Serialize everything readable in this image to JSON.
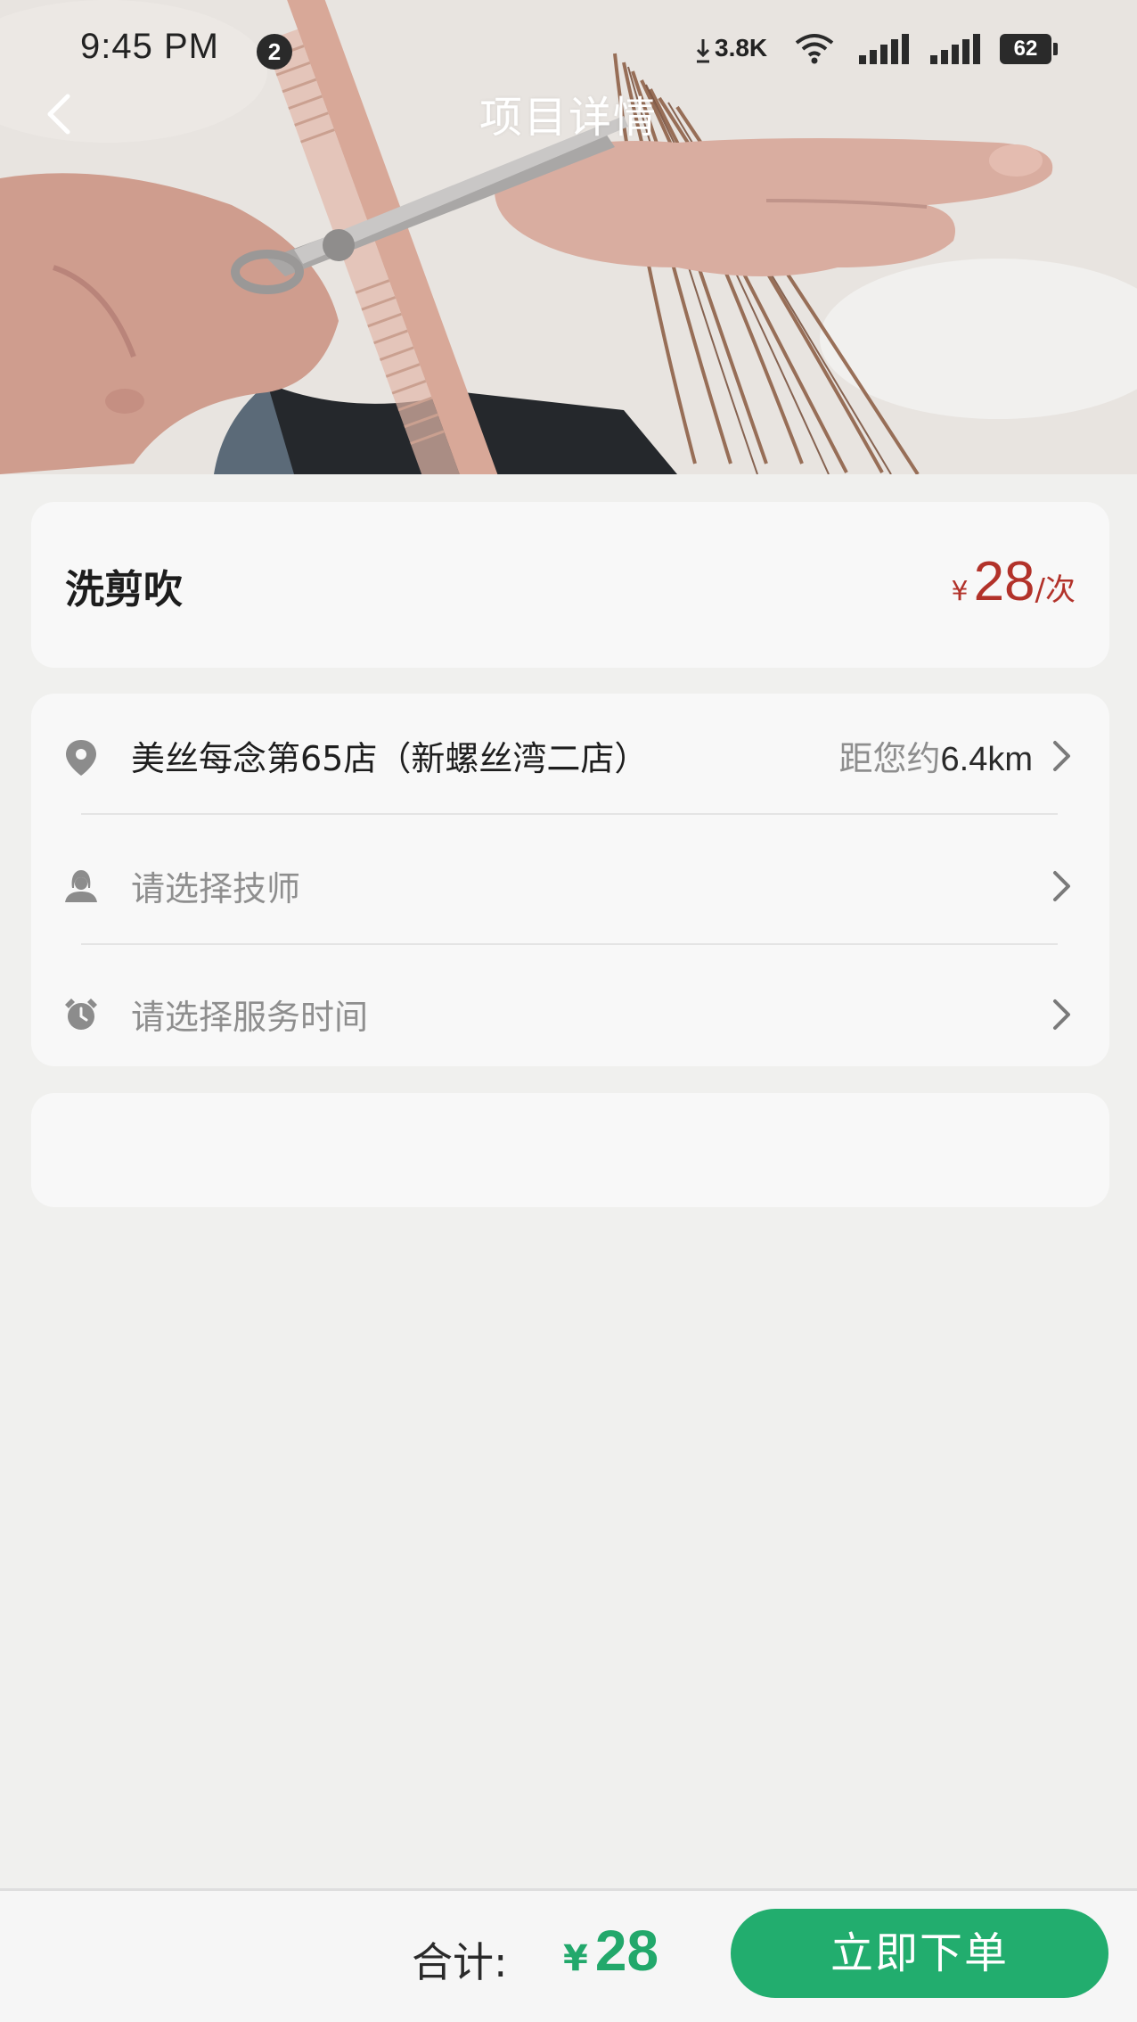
{
  "status_bar": {
    "time": "9:45 PM",
    "notification_count": "2",
    "network_speed": "3.8K",
    "battery": "62"
  },
  "header": {
    "title": "项目详情",
    "back_icon": "chevron-left-icon"
  },
  "service": {
    "name": "洗剪吹",
    "currency": "¥",
    "price": "28",
    "unit": "/次",
    "price_color": "#b2322a"
  },
  "options": {
    "store": {
      "icon": "location-pin-icon",
      "name": "美丝每念第65店（新螺丝湾二店）",
      "distance_prefix": "距您约",
      "distance": "6.4km"
    },
    "technician": {
      "icon": "stylist-icon",
      "placeholder": "请选择技师"
    },
    "time": {
      "icon": "alarm-clock-icon",
      "placeholder": "请选择服务时间"
    }
  },
  "footer": {
    "total_label": "合计:",
    "currency": "¥",
    "total": "28",
    "order_button": "立即下单",
    "accent_color": "#22ad6e"
  }
}
